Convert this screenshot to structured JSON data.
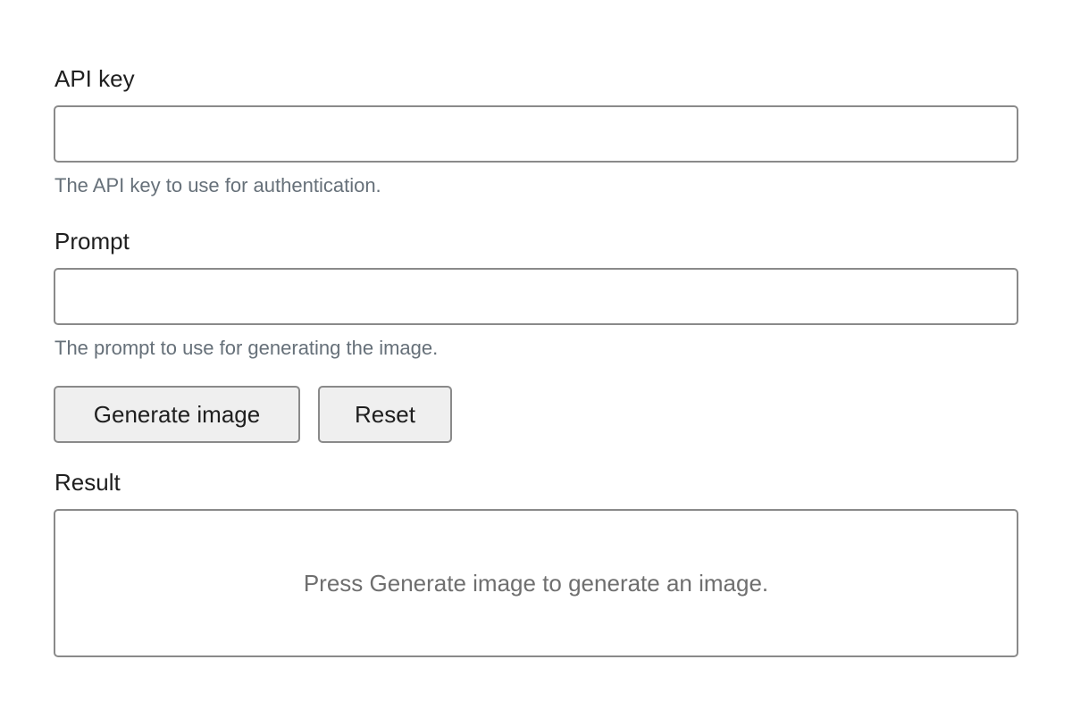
{
  "api_key": {
    "label": "API key",
    "value": "",
    "placeholder": "",
    "help": "The API key to use for authentication."
  },
  "prompt": {
    "label": "Prompt",
    "value": "",
    "placeholder": "",
    "help": "The prompt to use for generating the image."
  },
  "actions": {
    "generate_label": "Generate image",
    "reset_label": "Reset"
  },
  "result": {
    "label": "Result",
    "message": "Press Generate image to generate an image."
  }
}
